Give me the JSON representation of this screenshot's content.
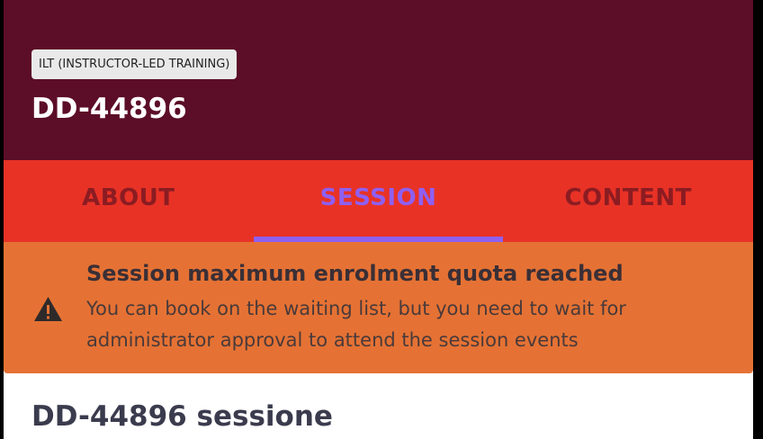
{
  "header": {
    "type_badge": "ILT (INSTRUCTOR-LED TRAINING)",
    "title": "DD-44896"
  },
  "tabs": [
    {
      "label": "ABOUT",
      "active": false
    },
    {
      "label": "SESSION",
      "active": true
    },
    {
      "label": "CONTENT",
      "active": false
    }
  ],
  "alert": {
    "icon": "warning-icon",
    "title": "Session maximum enrolment quota reached",
    "body": "You can book on the waiting list, but you need to wait for administrator approval to attend the session events"
  },
  "session": {
    "title": "DD-44896 sessione"
  },
  "colors": {
    "header_bg": "#5c0d27",
    "tabs_bg": "#e83226",
    "tab_active": "#8f5ff2",
    "tab_inactive": "#8b1c22",
    "alert_bg": "#e57234"
  }
}
